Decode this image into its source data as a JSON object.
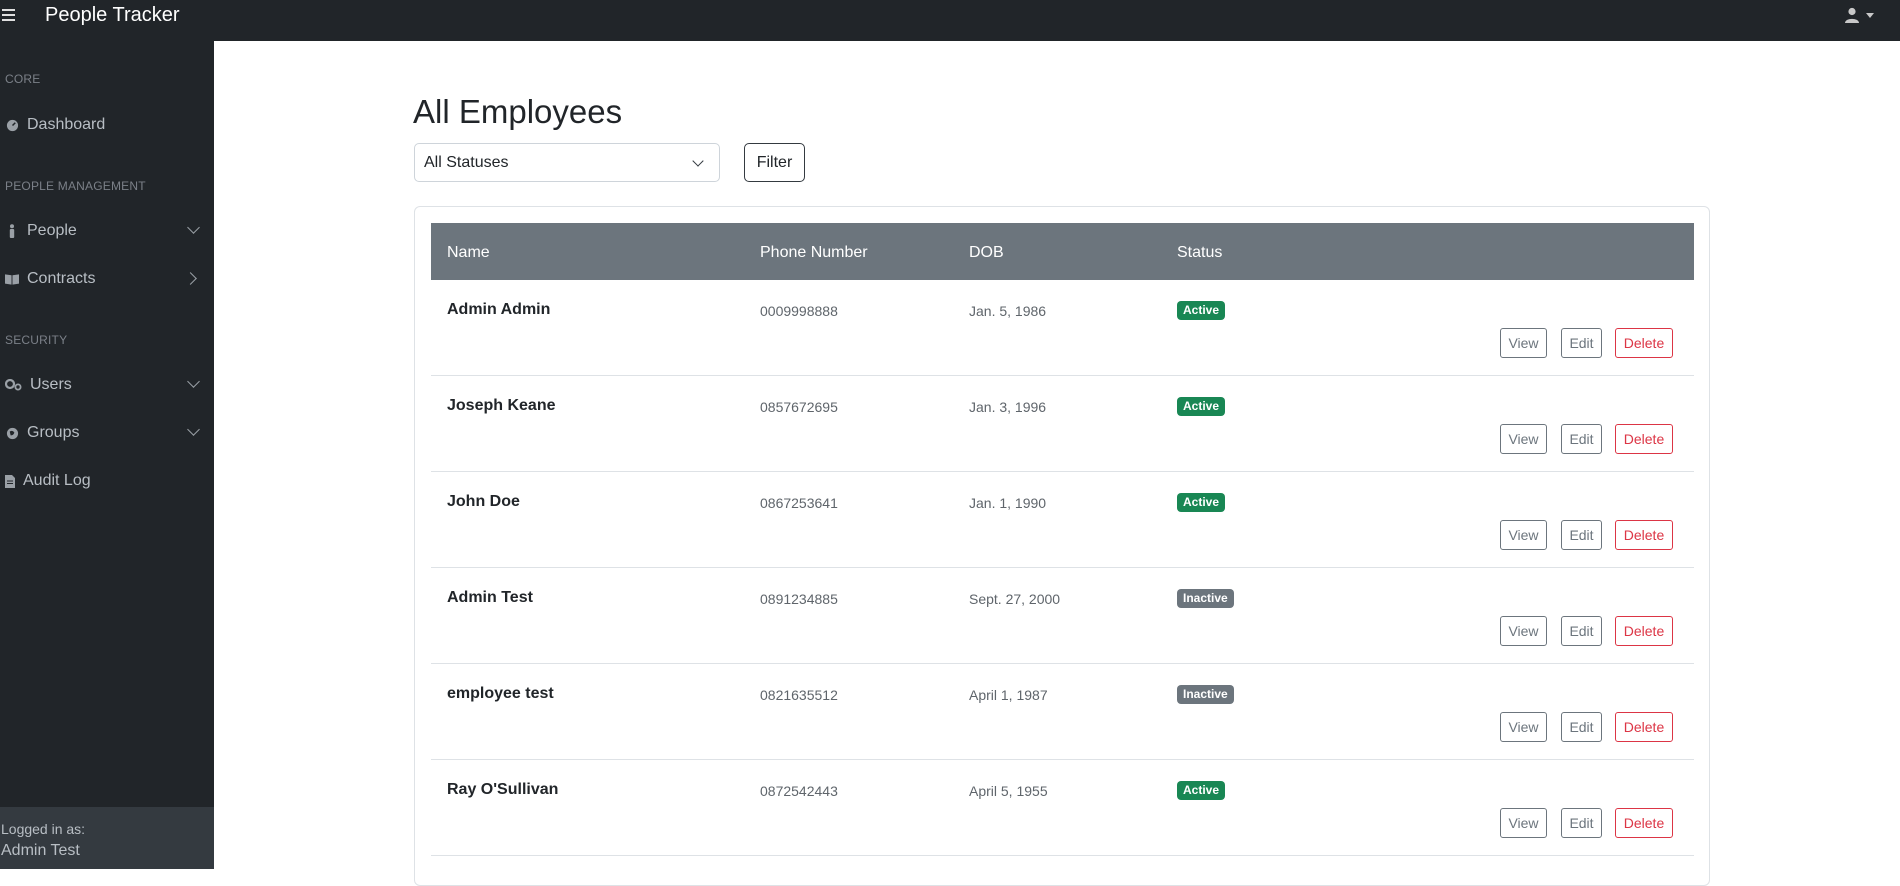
{
  "topbar": {
    "brand": "People Tracker"
  },
  "sidebar": {
    "headings": [
      "Core",
      "People Management",
      "Security"
    ],
    "items": [
      {
        "label": "Dashboard"
      },
      {
        "label": "People"
      },
      {
        "label": "Contracts"
      },
      {
        "label": "Users"
      },
      {
        "label": "Groups"
      },
      {
        "label": "Audit Log"
      }
    ],
    "footer": {
      "logged_in_label": "Logged in as:",
      "user": "Admin Test"
    }
  },
  "main": {
    "title": "All Employees",
    "filter": {
      "selected": "All Statuses",
      "button_label": "Filter"
    },
    "table": {
      "columns": [
        "Name",
        "Phone Number",
        "DOB",
        "Status"
      ],
      "actions": {
        "view": "View",
        "edit": "Edit",
        "delete": "Delete"
      },
      "rows": [
        {
          "name": "Admin Admin",
          "phone": "0009998888",
          "dob": "Jan. 5, 1986",
          "status": "Active"
        },
        {
          "name": "Joseph Keane",
          "phone": "0857672695",
          "dob": "Jan. 3, 1996",
          "status": "Active"
        },
        {
          "name": "John Doe",
          "phone": "0867253641",
          "dob": "Jan. 1, 1990",
          "status": "Active"
        },
        {
          "name": "Admin Test",
          "phone": "0891234885",
          "dob": "Sept. 27, 2000",
          "status": "Inactive"
        },
        {
          "name": "employee test",
          "phone": "0821635512",
          "dob": "April 1, 1987",
          "status": "Inactive"
        },
        {
          "name": "Ray O'Sullivan",
          "phone": "0872542443",
          "dob": "April 5, 1955",
          "status": "Active"
        }
      ]
    }
  },
  "colors": {
    "topbar": "#212529",
    "active": "#198754",
    "inactive": "#6c757d",
    "danger": "#dc3545",
    "table_header": "#6c757d"
  }
}
